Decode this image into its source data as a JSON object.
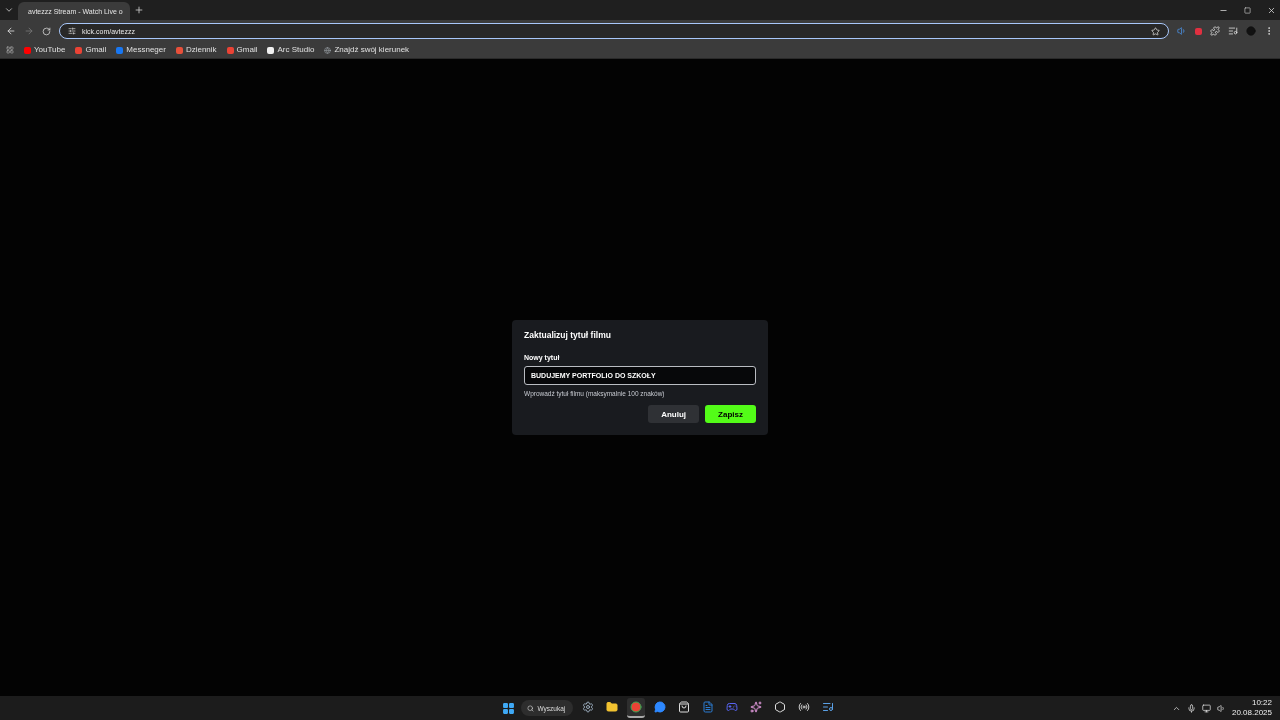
{
  "browser": {
    "tab": {
      "title": "avtezzz Stream - Watch Live o",
      "selected": true
    },
    "url": "kick.com/avtezzz",
    "bookmarks": [
      {
        "kind": "youtube",
        "label": "YouTube"
      },
      {
        "kind": "gmail",
        "label": "Gmail"
      },
      {
        "kind": "messenger",
        "label": "Messneger"
      },
      {
        "kind": "news",
        "label": "Dziennik"
      },
      {
        "kind": "gmail",
        "label": "Gmail"
      },
      {
        "kind": "arc",
        "label": "Arc Studio"
      },
      {
        "kind": "globe",
        "label": "Znajdź swój kierunek"
      }
    ]
  },
  "dialog": {
    "title": "Zaktualizuj tytuł filmu",
    "field_label": "Nowy tytuł",
    "value": "BUDUJEMY PORTFOLIO DO SZKOŁY",
    "hint": "Wprowadź tytuł filmu (maksymalnie 100 znaków)",
    "buttons": [
      {
        "kind": "secondary",
        "label": "Anuluj"
      },
      {
        "kind": "primary",
        "label": "Zapisz"
      }
    ]
  },
  "taskbar": {
    "search": "Wyszukaj",
    "apps": [
      {
        "kind": "settings",
        "active": false
      },
      {
        "kind": "files",
        "active": false
      },
      {
        "kind": "chrome",
        "active": true
      },
      {
        "kind": "messenger",
        "active": false
      },
      {
        "kind": "store",
        "active": false
      },
      {
        "kind": "word",
        "active": false
      },
      {
        "kind": "discord",
        "active": false
      },
      {
        "kind": "copilot",
        "active": false
      },
      {
        "kind": "chatgpt",
        "active": false
      },
      {
        "kind": "recorder",
        "active": false
      },
      {
        "kind": "notes",
        "active": false
      }
    ],
    "time": "10:22",
    "date": "20.08.2025"
  }
}
